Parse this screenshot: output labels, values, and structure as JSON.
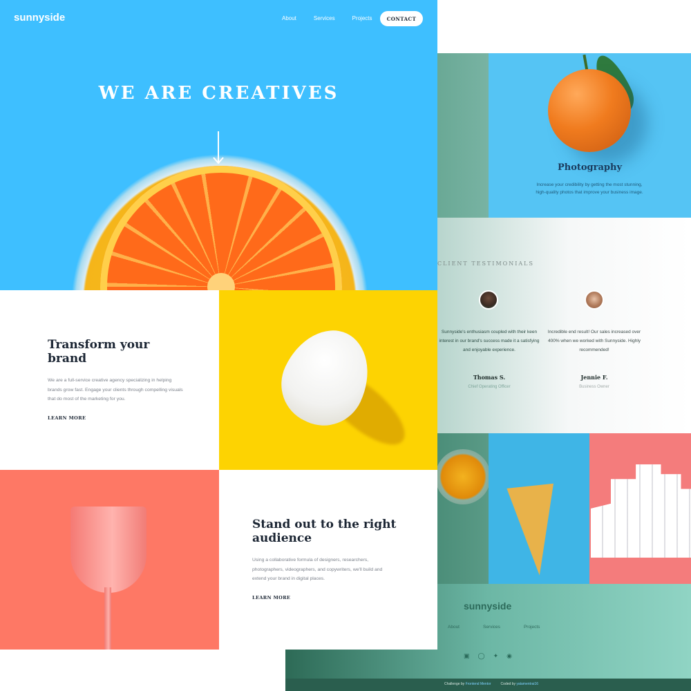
{
  "front": {
    "logo": "sunnyside",
    "nav": [
      "About",
      "Services",
      "Projects"
    ],
    "contact_label": "CONTACT",
    "hero_title": "WE ARE CREATIVES",
    "brand": {
      "title": "Transform your brand",
      "text": "We are a full-service creative agency specializing in helping brands grow fast. Engage your clients through compelling visuals that do most of the marketing for you.",
      "cta": "LEARN MORE"
    },
    "audience": {
      "title": "Stand out to the right audience",
      "text": "Using a collaborative formula of designers, researchers, photographers, videographers, and copywriters, we'll build and extend your brand in digital places.",
      "cta": "LEARN MORE"
    },
    "colors": {
      "hero": "#3ebfff",
      "egg": "#fdd302",
      "cup": "#fe7865"
    }
  },
  "back": {
    "photography": {
      "title": "Photography",
      "text": "Increase your credibility by getting the most stunning, high-quality photos that improve your business image."
    },
    "testimonials": {
      "heading": "CLIENT TESTIMONIALS",
      "items": [
        {
          "quote": "Sunnyside's enthusiasm coupled with their keen interest in our brand's success made it a satisfying and enjoyable experience.",
          "name": "Thomas S.",
          "role": "Chief Operating Officer"
        },
        {
          "quote": "Incredible end result! Our sales increased over 400% when we worked with Sunnyside. Highly recommended!",
          "name": "Jennie F.",
          "role": "Business Owner"
        }
      ]
    },
    "footer": {
      "logo": "sunnyside",
      "links": [
        "About",
        "Services",
        "Projects"
      ],
      "social_icons": [
        "facebook-icon",
        "instagram-icon",
        "twitter-icon",
        "pinterest-icon"
      ],
      "credit_left": "Challenge by",
      "credit_left_link": "Frontend Mentor",
      "credit_right": "Coded by",
      "credit_right_link": "yatamentrai16"
    }
  }
}
